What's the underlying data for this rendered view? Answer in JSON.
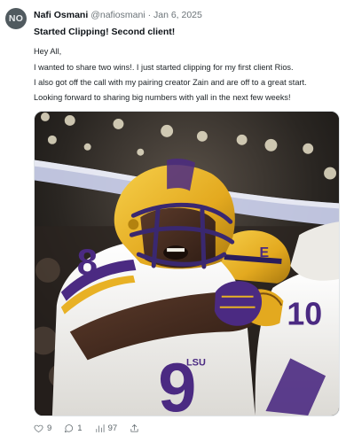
{
  "author": {
    "avatar_initials": "NO",
    "name": "Nafi Osmani",
    "handle": "@nafiosmani",
    "separator": "·",
    "date": "Jan 6, 2025"
  },
  "post": {
    "title": "Started Clipping! Second client!",
    "lines": [
      "Hey All,",
      "I wanted to share two wins!. I just started clipping for my first client Rios.",
      "I also got off the call with my pairing creator Zain and are off to a great start.",
      "Looking forward to sharing big numbers with yall in the next few weeks!"
    ],
    "image": {
      "jersey_numbers": [
        "8",
        "9",
        "E",
        "10"
      ],
      "jersey_mark": "LSU"
    }
  },
  "actions": {
    "likes": "9",
    "replies": "1",
    "views": "97"
  },
  "colors": {
    "gold": "#e8b125",
    "purple": "#4b2a82",
    "jersey_white": "#f4f2ee"
  },
  "icons": [
    "heart-icon",
    "reply-icon",
    "views-icon",
    "share-icon"
  ]
}
